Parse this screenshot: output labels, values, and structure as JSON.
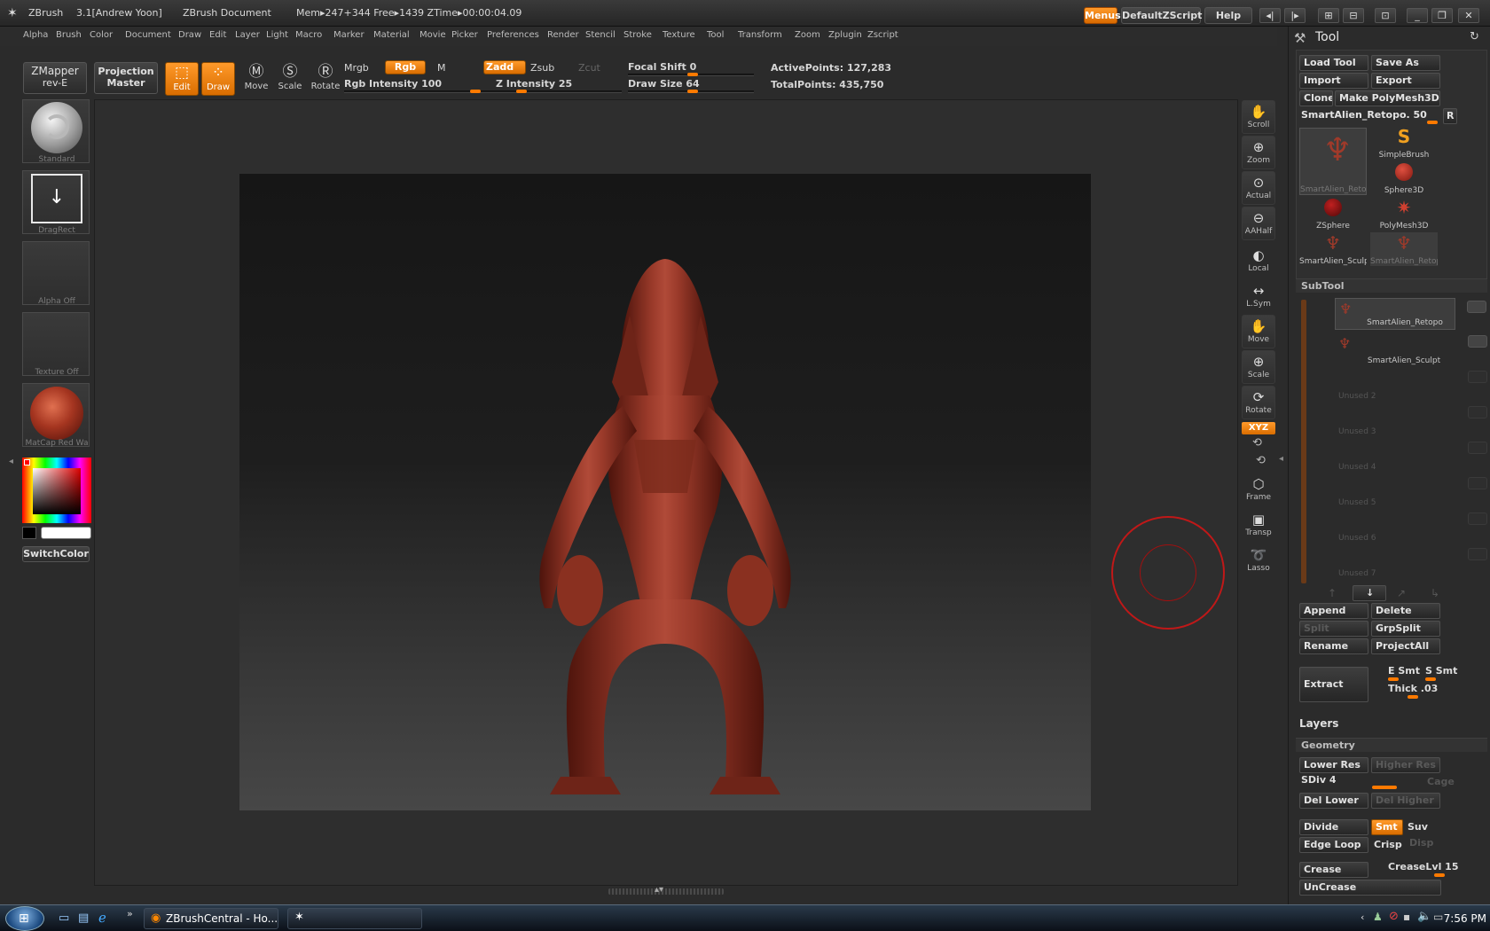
{
  "titlebar": {
    "app": "ZBrush",
    "version": "3.1[Andrew Yoon]",
    "document": "ZBrush Document",
    "stats": "Mem▸247+344 Free▸1439 ZTime▸00:00:04.09",
    "menus_btn": "Menus",
    "zscript_btn": "DefaultZScript",
    "help_btn": "Help"
  },
  "menus": [
    "Alpha",
    "Brush",
    "Color",
    "Document",
    "Draw",
    "Edit",
    "Layer",
    "Light",
    "Macro",
    "Marker",
    "Material",
    "Movie",
    "Picker",
    "Preferences",
    "Render",
    "Stencil",
    "Stroke",
    "Texture",
    "Tool",
    "Transform",
    "Zoom",
    "Zplugin",
    "Zscript"
  ],
  "shelf": {
    "zmapper_line1": "ZMapper",
    "zmapper_line2": "rev-E",
    "projection_line1": "Projection",
    "projection_line2": "Master",
    "edit": "Edit",
    "draw": "Draw",
    "move": "Move",
    "scale": "Scale",
    "rotate": "Rotate",
    "mrgb": "Mrgb",
    "rgb": "Rgb",
    "m": "M",
    "zadd": "Zadd",
    "zsub": "Zsub",
    "zcut": "Zcut",
    "rgb_intensity": "Rgb Intensity 100",
    "z_intensity": "Z Intensity 25",
    "focal_shift": "Focal Shift 0",
    "draw_size": "Draw Size 64",
    "active_points": "ActivePoints: 127,283",
    "total_points": "TotalPoints: 435,750",
    "rgb_intensity_level": 1.0,
    "z_intensity_level": 0.25,
    "focal_shift_level": 0.5,
    "draw_size_level": 0.5
  },
  "left": {
    "brush": "Standard",
    "stroke": "DragRect",
    "alpha": "Alpha  Off",
    "texture": "Texture  Off",
    "material": "MatCap  Red  Wa",
    "switch_color": "SwitchColor"
  },
  "right_toolbar": [
    "Scroll",
    "Zoom",
    "Actual",
    "AAHalf",
    "Local",
    "L.Sym",
    "Move",
    "Scale",
    "Rotate",
    "Frame",
    "Transp",
    "Lasso"
  ],
  "xyz": "XYZ",
  "tool": {
    "title": "Tool",
    "load_tool": "Load Tool",
    "save_as": "Save As",
    "import": "Import",
    "export": "Export",
    "clone": "Clone",
    "make_polymesh": "Make PolyMesh3D",
    "current": "SmartAlien_Retopo. 50",
    "r": "R",
    "thumbs": [
      "SmartAlien_Retop",
      "SimpleBrush",
      "Sphere3D",
      "ZSphere",
      "PolyMesh3D",
      "SmartAlien_Sculp",
      "SmartAlien_Retop"
    ]
  },
  "subtool": {
    "title": "SubTool",
    "items": [
      "SmartAlien_Retopo",
      "SmartAlien_Sculpt",
      "Unused  2",
      "Unused  3",
      "Unused  4",
      "Unused  5",
      "Unused  6",
      "Unused  7"
    ],
    "append": "Append",
    "delete": "Delete",
    "split": "Split",
    "grpsplit": "GrpSplit",
    "rename": "Rename",
    "projectall": "ProjectAll",
    "extract": "Extract",
    "e_smt": "E Smt",
    "s_smt": "S Smt",
    "thick": "Thick .03"
  },
  "layers": {
    "title": "Layers"
  },
  "geometry": {
    "title": "Geometry",
    "lower_res": "Lower Res",
    "higher_res": "Higher Res",
    "sdiv": "SDiv 4",
    "cage": "Cage",
    "del_lower": "Del Lower",
    "del_higher": "Del Higher",
    "divide": "Divide",
    "smt": "Smt",
    "suv": "Suv",
    "edge_loop": "Edge Loop",
    "crisp": "Crisp",
    "disp": "Disp",
    "crease": "Crease",
    "crease_lvl": "CreaseLvl 15",
    "uncrease": "UnCrease"
  },
  "taskbar": {
    "task1": "ZBrushCentral - Ho...",
    "clock": "7:56 PM"
  },
  "colors": {
    "accent": "#ff8a10",
    "model": "#8a2e22",
    "brush_cursor": "#c01818"
  }
}
